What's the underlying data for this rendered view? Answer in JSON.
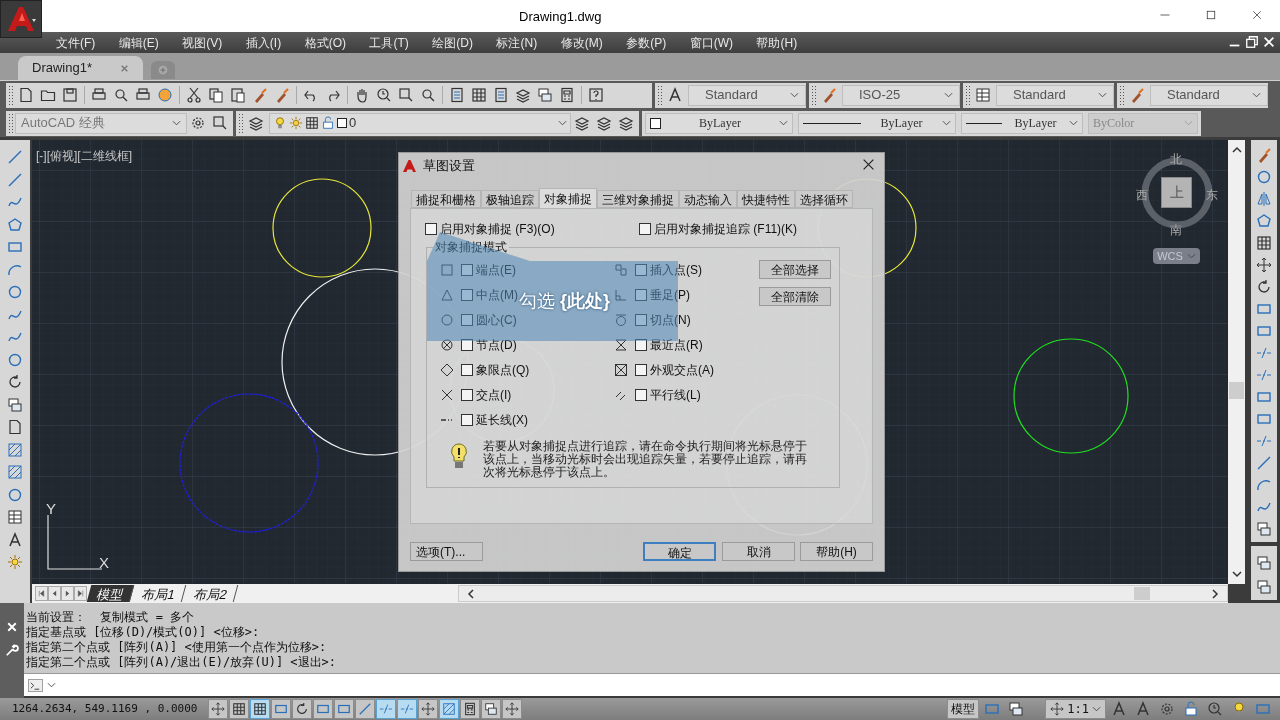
{
  "title_bar": {
    "title": "Drawing1.dwg"
  },
  "menu": [
    "文件(F)",
    "编辑(E)",
    "视图(V)",
    "插入(I)",
    "格式(O)",
    "工具(T)",
    "绘图(D)",
    "标注(N)",
    "修改(M)",
    "参数(P)",
    "窗口(W)",
    "帮助(H)"
  ],
  "file_tabs": [
    {
      "label": "Drawing1*",
      "selected": true
    }
  ],
  "style_dropdowns": [
    {
      "value": "Standard"
    },
    {
      "value": "ISO-25"
    },
    {
      "value": "Standard"
    },
    {
      "value": "Standard"
    }
  ],
  "workspace": {
    "value": "AutoCAD 经典"
  },
  "layer": {
    "value": "0"
  },
  "property_dropdowns": [
    {
      "kind": "color",
      "value": "ByLayer",
      "disabled": false
    },
    {
      "kind": "linetype",
      "value": "ByLayer",
      "disabled": false
    },
    {
      "kind": "lineweight",
      "value": "ByLayer",
      "disabled": false
    },
    {
      "kind": "plotstyle",
      "value": "ByColor",
      "disabled": true
    }
  ],
  "viewport_label": "[-][俯视][二维线框]",
  "viewcube": {
    "north": "北",
    "south": "南",
    "west": "西",
    "east": "东",
    "face": "上",
    "ucs": "WCS"
  },
  "ucs_icon": {
    "x_label": "X",
    "y_label": "Y"
  },
  "layout_tabs": [
    {
      "label": "模型",
      "selected": true
    },
    {
      "label": "布局1",
      "selected": false
    },
    {
      "label": "布局2",
      "selected": false
    }
  ],
  "command_history": [
    "当前设置：  复制模式 = 多个",
    "指定基点或 [位移(D)/模式(O)] <位移>:",
    "指定第二个点或 [阵列(A)] <使用第一个点作为位移>:",
    "指定第二个点或 [阵列(A)/退出(E)/放弃(U)] <退出>:"
  ],
  "status_bar": {
    "coordinates": "1264.2634, 549.1169 , 0.0000",
    "toggles": [
      {
        "on": false
      },
      {
        "on": false
      },
      {
        "on": true
      },
      {
        "on": false
      },
      {
        "on": false
      },
      {
        "on": false
      },
      {
        "on": false
      },
      {
        "on": false
      },
      {
        "on": true
      },
      {
        "on": true
      },
      {
        "on": false
      },
      {
        "on": true
      },
      {
        "on": false
      },
      {
        "on": false
      },
      {
        "on": false
      }
    ],
    "space": "模型",
    "annotation_scale": "1:1"
  },
  "dialog": {
    "title": "草图设置",
    "tabs": [
      {
        "label": "捕捉和栅格",
        "selected": false
      },
      {
        "label": "极轴追踪",
        "selected": false
      },
      {
        "label": "对象捕捉",
        "selected": true
      },
      {
        "label": "三维对象捕捉",
        "selected": false
      },
      {
        "label": "动态输入",
        "selected": false
      },
      {
        "label": "快捷特性",
        "selected": false
      },
      {
        "label": "选择循环",
        "selected": false
      }
    ],
    "enable_snap": {
      "label": "启用对象捕捉 (F3)(O)",
      "checked": false
    },
    "enable_tracking": {
      "label": "启用对象捕捉追踪 (F11)(K)",
      "checked": false
    },
    "group_title": "对象捕捉模式",
    "left_modes": [
      {
        "kind": "square",
        "label": "端点(E)",
        "checked": false
      },
      {
        "kind": "triangle",
        "label": "中点(M)",
        "checked": false
      },
      {
        "kind": "circle",
        "label": "圆心(C)",
        "checked": false
      },
      {
        "kind": "node",
        "label": "节点(D)",
        "checked": false
      },
      {
        "kind": "diamond",
        "label": "象限点(Q)",
        "checked": false
      },
      {
        "kind": "cross",
        "label": "交点(I)",
        "checked": false
      },
      {
        "kind": "extension",
        "label": "延长线(X)",
        "checked": false
      }
    ],
    "right_modes": [
      {
        "kind": "insertion",
        "label": "插入点(S)",
        "checked": false
      },
      {
        "kind": "perpendicular",
        "label": "垂足(P)",
        "checked": false
      },
      {
        "kind": "tangent",
        "label": "切点(N)",
        "checked": false
      },
      {
        "kind": "nearest",
        "label": "最近点(R)",
        "checked": false
      },
      {
        "kind": "apparent",
        "label": "外观交点(A)",
        "checked": false
      },
      {
        "kind": "parallel",
        "label": "平行线(L)",
        "checked": false
      }
    ],
    "select_all": "全部选择",
    "clear_all": "全部清除",
    "hint": "若要从对象捕捉点进行追踪，请在命令执行期间将光标悬停于该点上，当移动光标时会出现追踪矢量，若要停止追踪，请再次将光标悬停于该点上。",
    "options_button": "选项(T)...",
    "ok_button": "确定",
    "cancel_button": "取消",
    "help_button": "帮助(H)"
  },
  "callout": {
    "text": "勾选 **{此处}**"
  }
}
